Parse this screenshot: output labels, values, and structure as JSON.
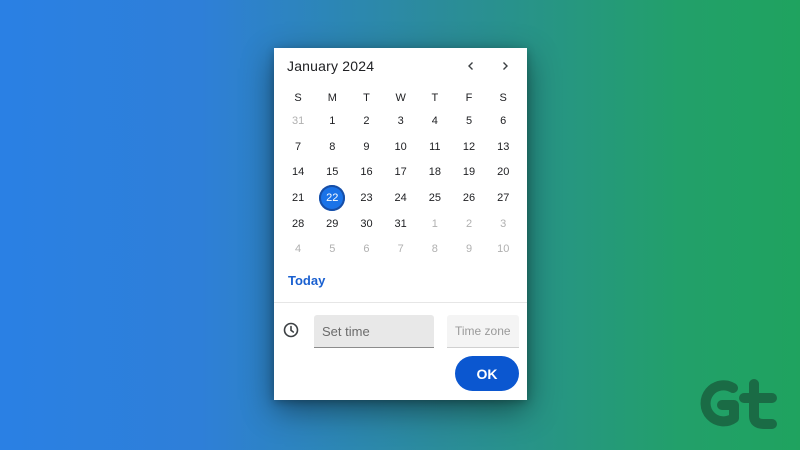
{
  "calendar": {
    "month_label": "January 2024",
    "prev_icon": "chevron-left-icon",
    "next_icon": "chevron-right-icon",
    "weekdays": [
      "S",
      "M",
      "T",
      "W",
      "T",
      "F",
      "S"
    ],
    "weeks": [
      [
        {
          "d": "31",
          "muted": true
        },
        {
          "d": "1"
        },
        {
          "d": "2"
        },
        {
          "d": "3"
        },
        {
          "d": "4"
        },
        {
          "d": "5"
        },
        {
          "d": "6"
        }
      ],
      [
        {
          "d": "7"
        },
        {
          "d": "8"
        },
        {
          "d": "9"
        },
        {
          "d": "10"
        },
        {
          "d": "11"
        },
        {
          "d": "12"
        },
        {
          "d": "13"
        }
      ],
      [
        {
          "d": "14"
        },
        {
          "d": "15"
        },
        {
          "d": "16"
        },
        {
          "d": "17"
        },
        {
          "d": "18"
        },
        {
          "d": "19"
        },
        {
          "d": "20"
        }
      ],
      [
        {
          "d": "21"
        },
        {
          "d": "22",
          "selected": true
        },
        {
          "d": "23"
        },
        {
          "d": "24"
        },
        {
          "d": "25"
        },
        {
          "d": "26"
        },
        {
          "d": "27"
        }
      ],
      [
        {
          "d": "28"
        },
        {
          "d": "29"
        },
        {
          "d": "30"
        },
        {
          "d": "31"
        },
        {
          "d": "1",
          "muted": true
        },
        {
          "d": "2",
          "muted": true
        },
        {
          "d": "3",
          "muted": true
        }
      ],
      [
        {
          "d": "4",
          "muted": true
        },
        {
          "d": "5",
          "muted": true
        },
        {
          "d": "6",
          "muted": true
        },
        {
          "d": "7",
          "muted": true
        },
        {
          "d": "8",
          "muted": true
        },
        {
          "d": "9",
          "muted": true
        },
        {
          "d": "10",
          "muted": true
        }
      ]
    ],
    "today_label": "Today",
    "selected_color": "#1a73e8"
  },
  "time": {
    "clock_icon": "clock-icon",
    "set_time_placeholder": "Set time",
    "timezone_placeholder": "Time zone"
  },
  "actions": {
    "ok_label": "OK",
    "ok_color": "#0b57d0"
  },
  "watermark": {
    "logo_icon": "gt-logo-icon"
  }
}
